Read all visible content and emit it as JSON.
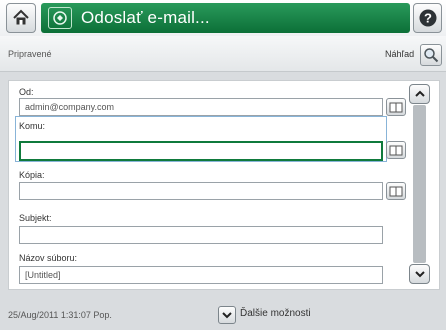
{
  "header": {
    "title": "Odoslať e-mail...",
    "home_icon": "home-icon",
    "title_icon": "email-icon",
    "help_icon": "help-icon",
    "accent_color": "#137a3f"
  },
  "status": {
    "text": "Pripravené",
    "preview_label": "Náhľad",
    "preview_icon": "magnifier-icon"
  },
  "form": {
    "from": {
      "label": "Od:",
      "value": "admin@company.com"
    },
    "to": {
      "label": "Komu:",
      "value": ""
    },
    "cc": {
      "label": "Kópia:",
      "value": ""
    },
    "subject": {
      "label": "Subjekt:",
      "value": ""
    },
    "filename": {
      "label": "Názov súboru:",
      "value": "[Untitled]"
    },
    "address_book_icon": "address-book-icon"
  },
  "scroll": {
    "up_icon": "chevron-up-icon",
    "down_icon": "chevron-down-icon"
  },
  "footer": {
    "timestamp": "25/Aug/2011 1:31:07 Pop.",
    "more_label": "Ďalšie možnosti",
    "more_icon": "chevron-down-icon"
  }
}
